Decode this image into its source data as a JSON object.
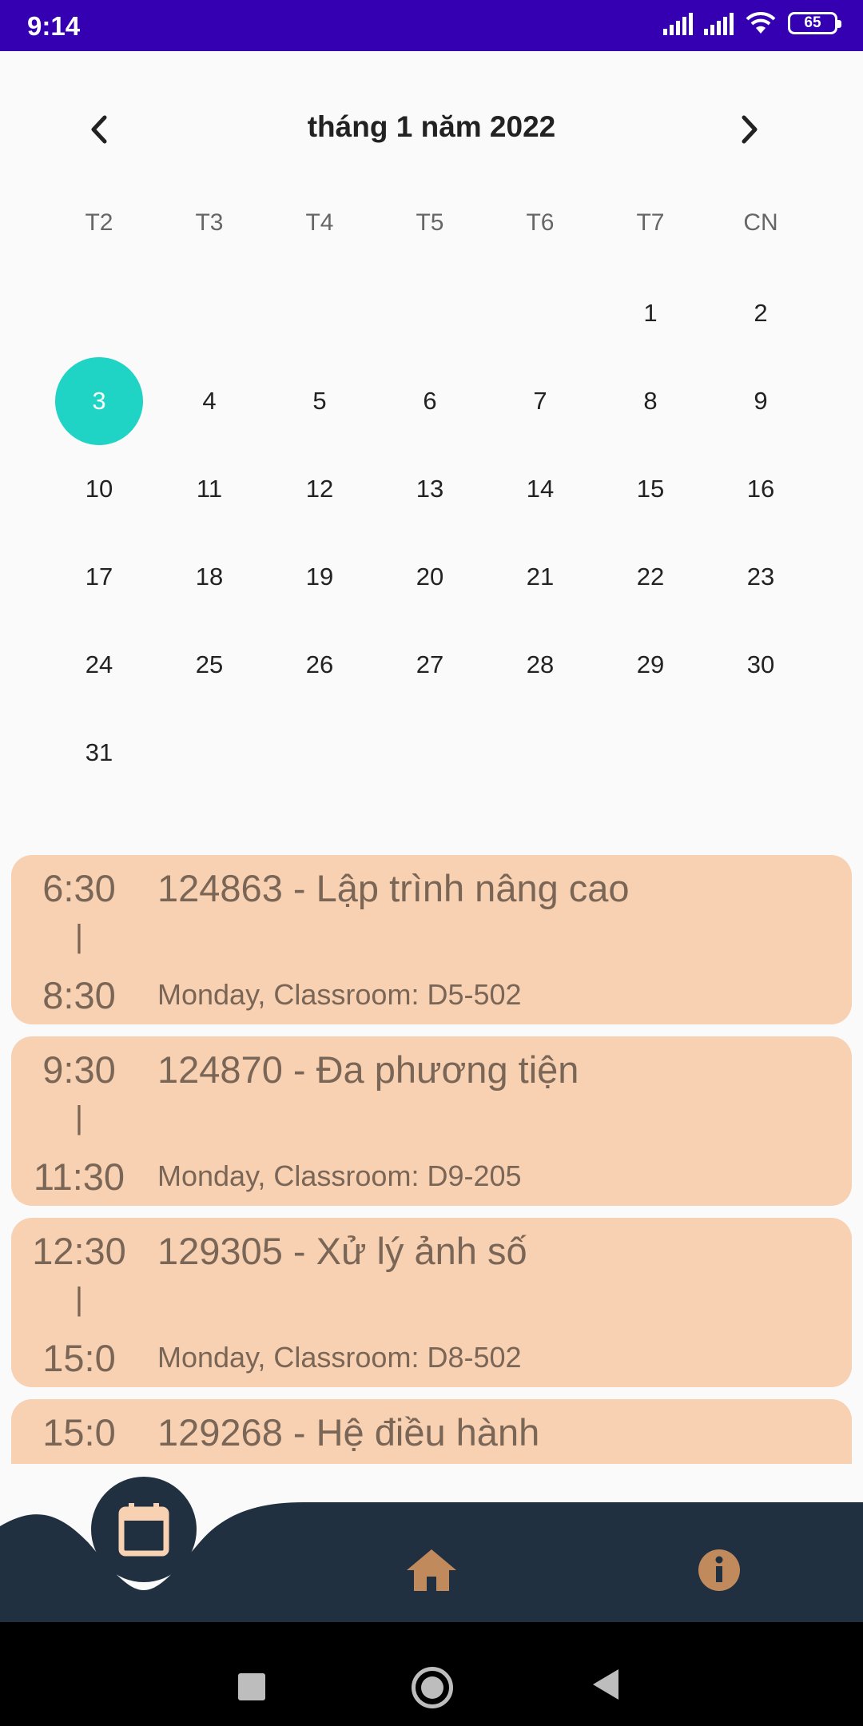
{
  "status_bar": {
    "time": "9:14",
    "battery": "65"
  },
  "calendar": {
    "month_title": "tháng 1 năm 2022",
    "weekdays": [
      "T2",
      "T3",
      "T4",
      "T5",
      "T6",
      "T7",
      "CN"
    ],
    "selected_day": "3",
    "weeks": [
      [
        "",
        "",
        "",
        "",
        "",
        "1",
        "2"
      ],
      [
        "3",
        "4",
        "5",
        "6",
        "7",
        "8",
        "9"
      ],
      [
        "10",
        "11",
        "12",
        "13",
        "14",
        "15",
        "16"
      ],
      [
        "17",
        "18",
        "19",
        "20",
        "21",
        "22",
        "23"
      ],
      [
        "24",
        "25",
        "26",
        "27",
        "28",
        "29",
        "30"
      ],
      [
        "31",
        "",
        "",
        "",
        "",
        "",
        ""
      ]
    ]
  },
  "events": [
    {
      "start": "6:30",
      "separator": "|",
      "end": "8:30",
      "title": "124863 - Lập trình nâng cao",
      "detail": "Monday, Classroom: D5-502"
    },
    {
      "start": "9:30",
      "separator": "|",
      "end": "11:30",
      "title": "124870 - Đa phương tiện",
      "detail": "Monday, Classroom: D9-205"
    },
    {
      "start": "12:30",
      "separator": "|",
      "end": "15:0",
      "title": "129305 - Xử lý ảnh số",
      "detail": "Monday, Classroom: D8-502"
    },
    {
      "start": "15:0",
      "separator": "|",
      "end": "",
      "title": "129268 - Hệ điều hành",
      "detail": ""
    }
  ],
  "bottom_nav": {
    "items": [
      {
        "icon": "calendar-icon",
        "active": true
      },
      {
        "icon": "home-icon",
        "active": false
      },
      {
        "icon": "info-icon",
        "active": false
      }
    ],
    "colors": {
      "bar": "#203040",
      "accent": "#c08a5c",
      "active_icon": "#f8d0b2"
    }
  },
  "colors": {
    "selected_day": "#20d4c5",
    "event_card": "#f8d0b2",
    "status_bar": "#3400b2"
  }
}
